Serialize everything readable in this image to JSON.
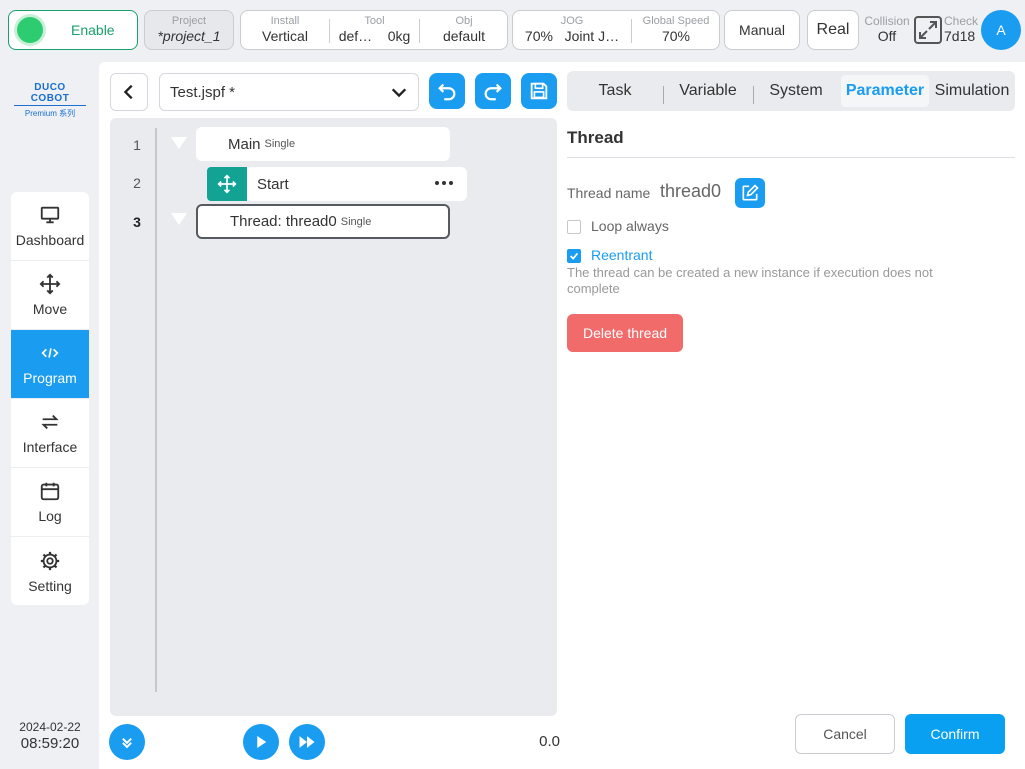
{
  "topbar": {
    "enable_label": "Enable",
    "project": {
      "label": "Project",
      "value": "*project_1"
    },
    "install": {
      "label": "Install",
      "value": "Vertical"
    },
    "tool": {
      "label": "Tool",
      "value": "def…",
      "value2": "0kg"
    },
    "obj": {
      "label": "Obj",
      "value": "default"
    },
    "jog": {
      "label": "JOG",
      "value": "70%",
      "value2": "Joint J…"
    },
    "global_speed": {
      "label": "Global Speed",
      "value": "70%"
    },
    "mode_button": "Manual",
    "real_button": "Real",
    "collision": {
      "label": "Collision",
      "value": "Off"
    },
    "check": {
      "label": "Check",
      "value": "7d18"
    },
    "avatar_letter": "A"
  },
  "brand": {
    "name": "DUCO COBOT",
    "sub": "Premium 系列"
  },
  "nav": {
    "items": [
      {
        "label": "Dashboard",
        "icon": "monitor-icon"
      },
      {
        "label": "Move",
        "icon": "move-arrows-icon"
      },
      {
        "label": "Program",
        "icon": "code-icon"
      },
      {
        "label": "Interface",
        "icon": "swap-icon"
      },
      {
        "label": "Log",
        "icon": "calendar-icon"
      },
      {
        "label": "Setting",
        "icon": "gear-icon"
      }
    ],
    "active": "Program"
  },
  "datetime": {
    "date": "2024-02-22",
    "time": "08:59:20"
  },
  "editor": {
    "file_name": "Test.jspf *",
    "tree": [
      {
        "line": "1",
        "title": "Main",
        "tag": "Single"
      },
      {
        "line": "2",
        "title": "Start"
      },
      {
        "line": "3",
        "title": "Thread: thread0",
        "tag": "Single"
      }
    ],
    "speed_value": "0.0"
  },
  "tabs": [
    "Task",
    "Variable",
    "System",
    "Parameter",
    "Simulation"
  ],
  "active_tab": "Parameter",
  "param": {
    "title": "Thread",
    "thread_name_label": "Thread name",
    "thread_name_value": "thread0",
    "loop_always_label": "Loop always",
    "loop_always_checked": false,
    "reentrant_label": "Reentrant",
    "reentrant_checked": true,
    "reentrant_desc": "The thread can be created a new instance if execution does not complete",
    "delete_label": "Delete thread"
  },
  "footer": {
    "cancel": "Cancel",
    "confirm": "Confirm"
  },
  "colors": {
    "accent": "#1a9cf0",
    "enable": "#1aa06d",
    "danger": "#f26b6b",
    "teal": "#12a394"
  }
}
